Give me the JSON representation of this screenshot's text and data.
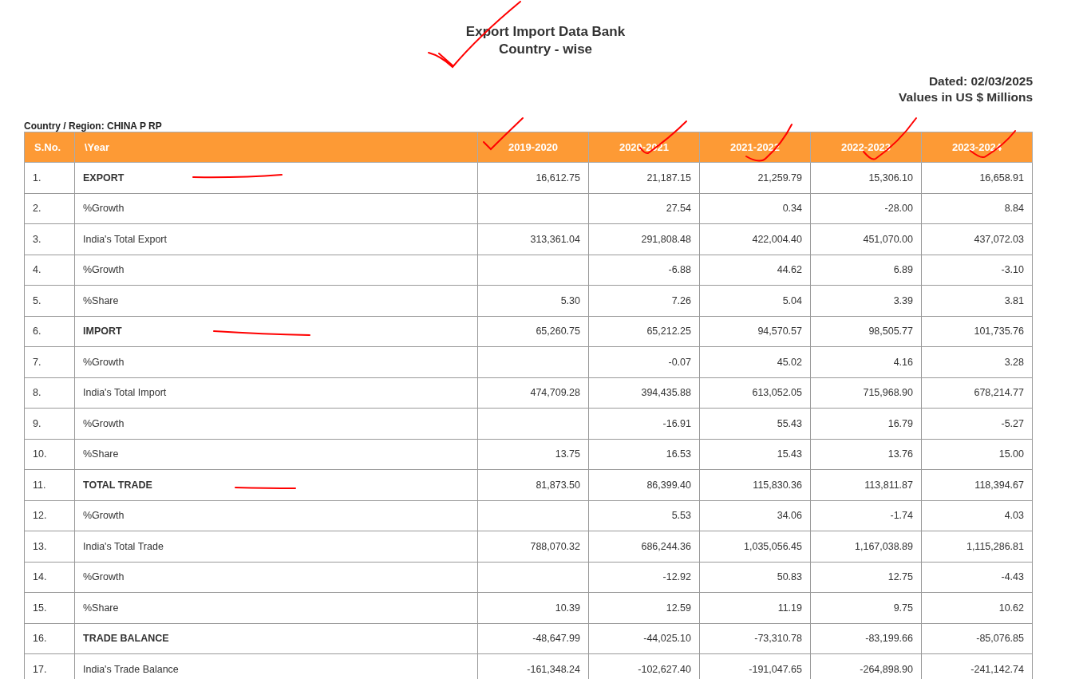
{
  "title": "Export Import Data Bank",
  "subtitle": "Country - wise",
  "dated": "Dated: 02/03/2025",
  "units": "Values in US $ Millions",
  "region": "Country / Region:  CHINA P RP",
  "table": {
    "columns": [
      "S.No.",
      "\\Year",
      "2019-2020",
      "2020-2021",
      "2021-2022",
      "2022-2023",
      "2023-2024"
    ],
    "rows": [
      {
        "no": "1.",
        "kind": "heading",
        "label": "EXPORT",
        "values": [
          "16,612.75",
          "21,187.15",
          "21,259.79",
          "15,306.10",
          "16,658.91"
        ]
      },
      {
        "no": "2.",
        "kind": "detail",
        "label": "%Growth",
        "values": [
          "27.54",
          "0.34",
          "-28.00",
          "8.84"
        ]
      },
      {
        "no": "3.",
        "kind": "detail",
        "label": "India's Total Export",
        "values": [
          "313,361.04",
          "291,808.48",
          "422,004.40",
          "451,070.00",
          "437,072.03"
        ]
      },
      {
        "no": "4.",
        "kind": "detail",
        "label": "%Growth",
        "values": [
          "-6.88",
          "44.62",
          "6.89",
          "-3.10"
        ]
      },
      {
        "no": "5.",
        "kind": "detail",
        "label": "%Share",
        "values": [
          "5.30",
          "7.26",
          "5.04",
          "3.39",
          "3.81"
        ]
      },
      {
        "no": "6.",
        "kind": "heading",
        "label": "IMPORT",
        "values": [
          "65,260.75",
          "65,212.25",
          "94,570.57",
          "98,505.77",
          "101,735.76"
        ]
      },
      {
        "no": "7.",
        "kind": "detail",
        "label": "%Growth",
        "values": [
          "-0.07",
          "45.02",
          "4.16",
          "3.28"
        ]
      },
      {
        "no": "8.",
        "kind": "detail",
        "label": "India's Total Import",
        "values": [
          "474,709.28",
          "394,435.88",
          "613,052.05",
          "715,968.90",
          "678,214.77"
        ]
      },
      {
        "no": "9.",
        "kind": "detail",
        "label": "%Growth",
        "values": [
          "-16.91",
          "55.43",
          "16.79",
          "-5.27"
        ]
      },
      {
        "no": "10.",
        "kind": "detail",
        "label": "%Share",
        "values": [
          "13.75",
          "16.53",
          "15.43",
          "13.76",
          "15.00"
        ]
      },
      {
        "no": "11.",
        "kind": "heading",
        "label": "TOTAL TRADE",
        "values": [
          "81,873.50",
          "86,399.40",
          "115,830.36",
          "113,811.87",
          "118,394.67"
        ]
      },
      {
        "no": "12.",
        "kind": "detail",
        "label": "%Growth",
        "values": [
          "5.53",
          "34.06",
          "-1.74",
          "4.03"
        ]
      },
      {
        "no": "13.",
        "kind": "detail",
        "label": "India's Total Trade",
        "values": [
          "788,070.32",
          "686,244.36",
          "1,035,056.45",
          "1,167,038.89",
          "1,115,286.81"
        ]
      },
      {
        "no": "14.",
        "kind": "detail",
        "label": "%Growth",
        "values": [
          "-12.92",
          "50.83",
          "12.75",
          "-4.43"
        ]
      },
      {
        "no": "15.",
        "kind": "detail",
        "label": "%Share",
        "values": [
          "10.39",
          "12.59",
          "11.19",
          "9.75",
          "10.62"
        ]
      },
      {
        "no": "16.",
        "kind": "heading",
        "label": "TRADE BALANCE",
        "values": [
          "-48,647.99",
          "-44,025.10",
          "-73,310.78",
          "-83,199.66",
          "-85,076.85"
        ]
      },
      {
        "no": "17.",
        "kind": "detail",
        "label": "India's Trade Balance",
        "values": [
          "-161,348.24",
          "-102,627.40",
          "-191,047.65",
          "-264,898.90",
          "-241,142.74"
        ]
      }
    ]
  }
}
